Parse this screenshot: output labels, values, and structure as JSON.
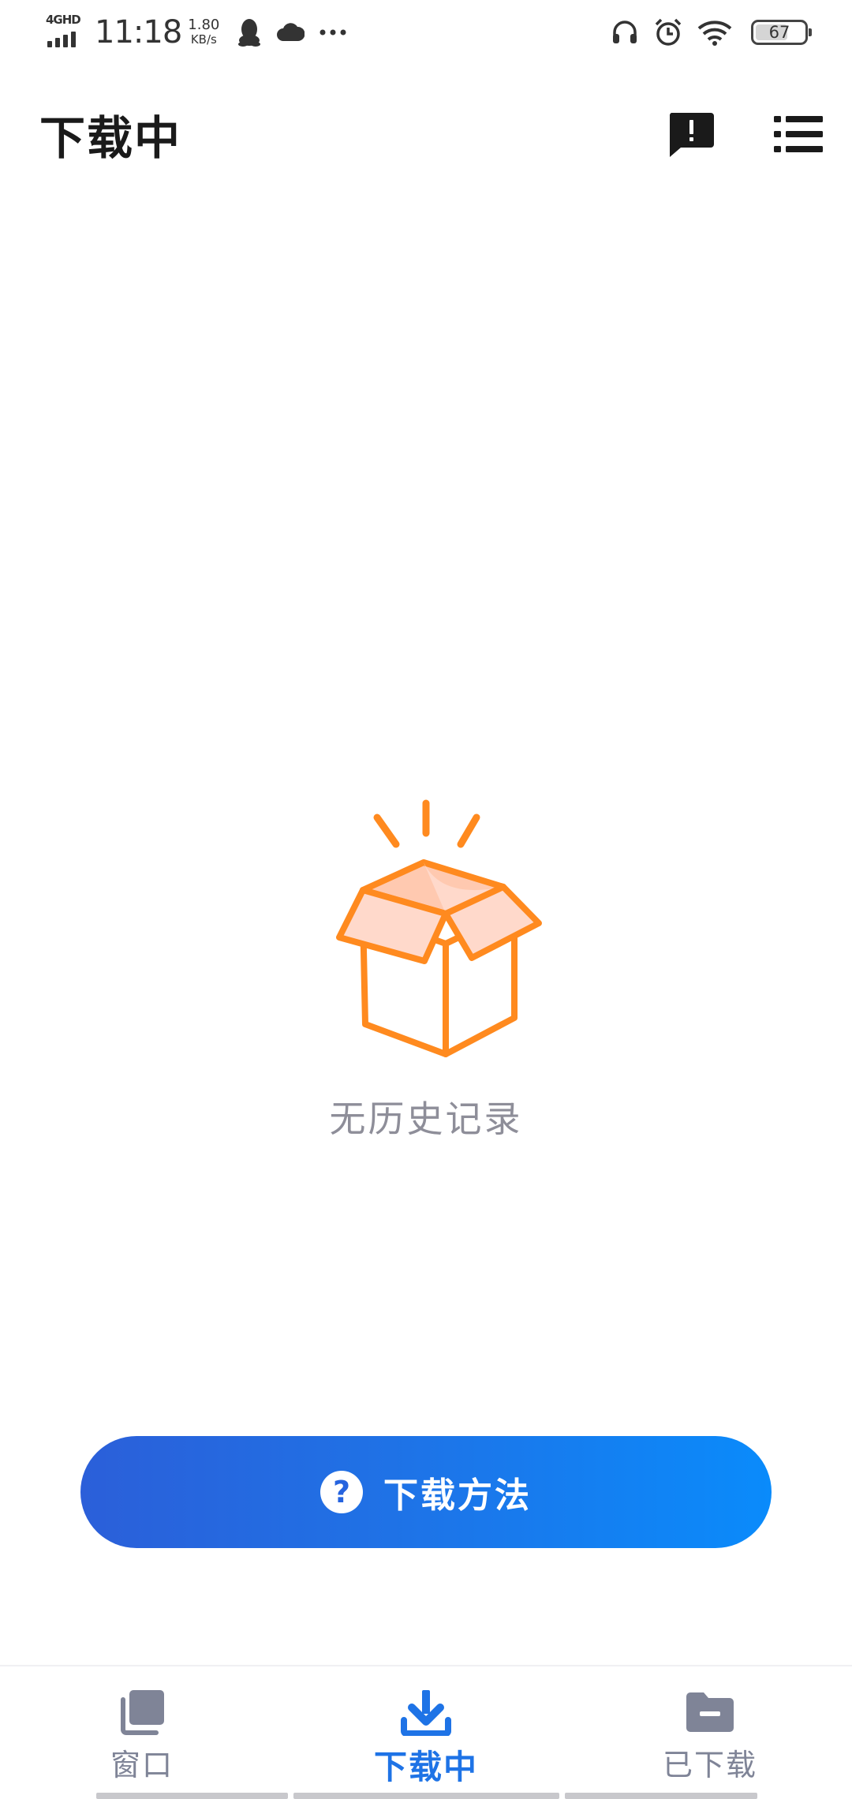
{
  "status_bar": {
    "network": "4GHD",
    "time": "11:18",
    "speed_value": "1.80",
    "speed_unit": "KB/s",
    "battery": "67",
    "battery_level": 0.67
  },
  "header": {
    "title": "下载中"
  },
  "empty_state": {
    "message": "无历史记录"
  },
  "cta": {
    "icon_glyph": "?",
    "label": "下载方法"
  },
  "bottom_nav": {
    "items": [
      {
        "label": "窗口",
        "icon": "windows-icon",
        "active": false
      },
      {
        "label": "下载中",
        "icon": "download-icon",
        "active": true
      },
      {
        "label": "已下载",
        "icon": "folder-icon",
        "active": false
      }
    ]
  },
  "colors": {
    "accent": "#1e73e6",
    "illustration": "#ff8a1f",
    "inactive_nav": "#7f8497",
    "empty_text": "#8e8e99"
  }
}
